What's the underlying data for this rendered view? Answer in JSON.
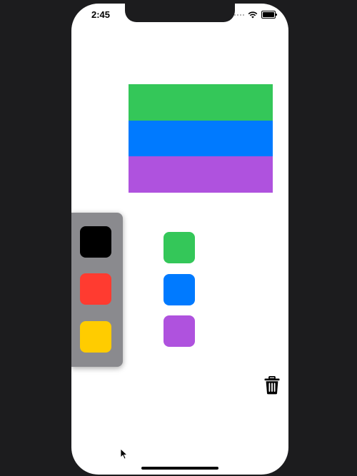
{
  "status_bar": {
    "time": "2:45",
    "icons": [
      "signal-icon",
      "wifi-icon",
      "battery-icon"
    ]
  },
  "stripes": [
    {
      "name": "green",
      "color": "#34C759"
    },
    {
      "name": "blue",
      "color": "#007AFF"
    },
    {
      "name": "purple",
      "color": "#AF52DE"
    }
  ],
  "palette": {
    "background": "#8A8A8E",
    "swatches": [
      {
        "name": "black",
        "color": "#000000"
      },
      {
        "name": "red",
        "color": "#FF3B30"
      },
      {
        "name": "yellow",
        "color": "#FFCC00"
      }
    ]
  },
  "tiles": [
    {
      "name": "green",
      "color": "#34C759"
    },
    {
      "name": "blue",
      "color": "#007AFF"
    },
    {
      "name": "purple",
      "color": "#AF52DE"
    }
  ],
  "icons": {
    "trash": "trash-icon",
    "cursor": "cursor-icon"
  }
}
